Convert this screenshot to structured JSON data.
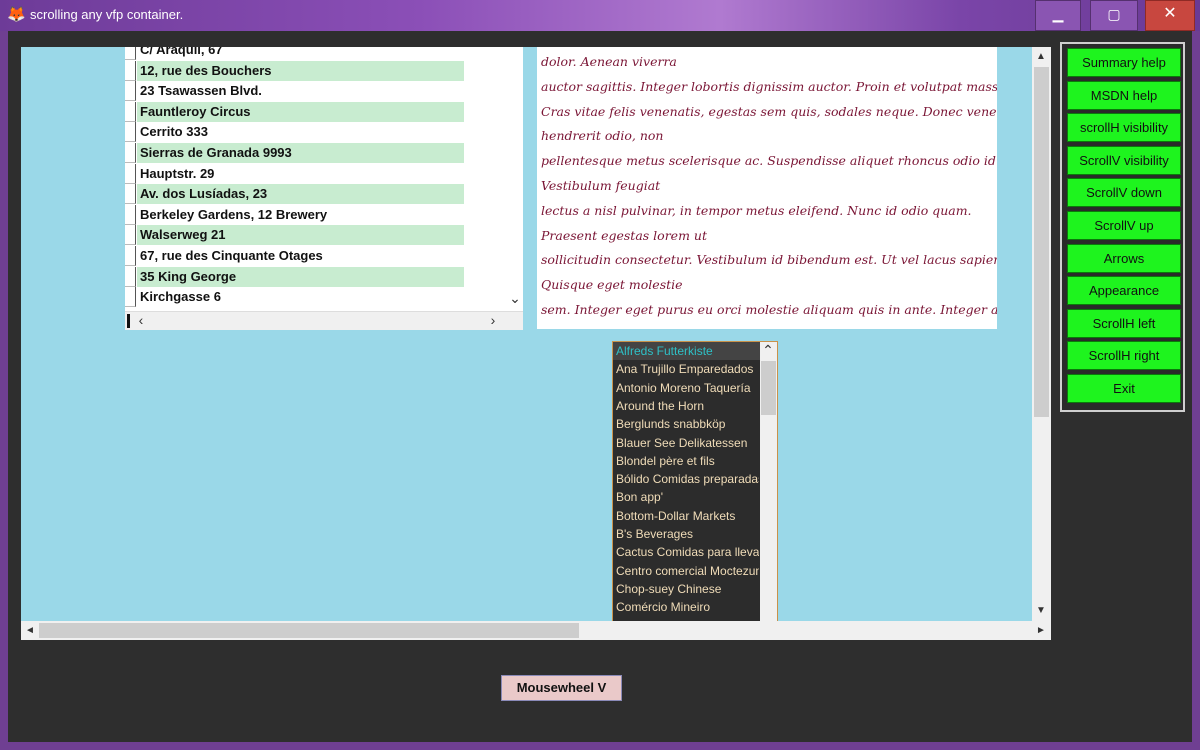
{
  "window": {
    "title": "scrolling any vfp container.",
    "minimize": "▁",
    "maximize": "▢",
    "close": "✕",
    "icon": "fox-icon"
  },
  "grid": {
    "rows": [
      "C/ Araquil, 67",
      "12, rue des Bouchers",
      "23 Tsawassen Blvd.",
      "Fauntleroy Circus",
      "Cerrito 333",
      "Sierras de Granada 9993",
      "Hauptstr. 29",
      "Av. dos Lusíadas, 23",
      "Berkeley Gardens, 12  Brewery",
      "Walserweg 21",
      "67, rue des Cinquante Otages",
      "35 King George",
      "Kirchgasse 6"
    ]
  },
  "editbox": {
    "lines": [
      "dolor. Aenean viverra",
      "auctor sagittis. Integer lobortis dignissim auctor. Proin et volutpat massa.",
      "Cras vitae felis venenatis, egestas sem quis, sodales neque. Donec venenatis",
      "hendrerit odio, non",
      "pellentesque metus scelerisque ac. Suspendisse aliquet rhoncus odio id viverra.",
      "Vestibulum feugiat",
      "lectus a nisl pulvinar, in tempor metus eleifend. Nunc id odio quam.",
      "Praesent egestas lorem ut",
      "sollicitudin consectetur. Vestibulum id bibendum est. Ut vel lacus sapien.",
      "Quisque eget molestie",
      "sem. Integer eget purus eu orci molestie aliquam quis in ante. Integer a"
    ]
  },
  "listbox": {
    "items": [
      "Alfreds Futterkiste",
      "Ana Trujillo Emparedados",
      "Antonio Moreno Taquería",
      "Around the Horn",
      "Berglunds snabbköp",
      "Blauer See Delikatessen",
      "Blondel père et fils",
      "Bólido Comidas preparadas",
      "Bon app'",
      "Bottom-Dollar Markets",
      "B's Beverages",
      "Cactus Comidas para llevar",
      "Centro comercial Moctezuma",
      "Chop-suey Chinese",
      "Comércio Mineiro"
    ],
    "selected_index": 0
  },
  "buttons": [
    "Summary help",
    "MSDN help",
    "scrollH visibility",
    "ScrollV visibility",
    "ScrollV down",
    "ScrollV up",
    "Arrows",
    "Appearance",
    "ScrollH left",
    "ScrollH right",
    "Exit"
  ],
  "mousewheel_button": "Mousewheel V",
  "arrows": {
    "up": "▲",
    "down": "▼",
    "left": "◄",
    "right": "►",
    "chev_left": "‹",
    "chev_right": "›",
    "chev_down": "⌄"
  },
  "colors": {
    "accent": "#1ef41e",
    "container": "#9ad8e8",
    "titlebar": "#7a45a8"
  }
}
